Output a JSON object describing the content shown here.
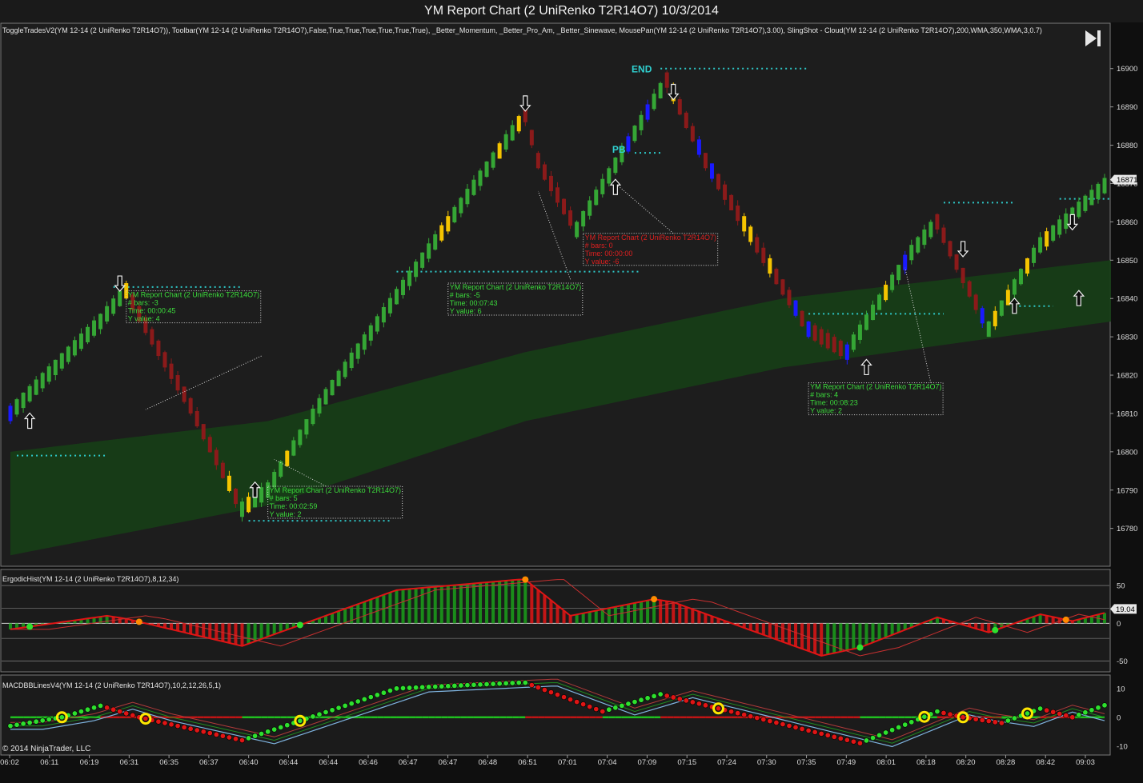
{
  "window": {
    "title": "YM Report Chart (2 UniRenko T2R14O7)  10/3/2014"
  },
  "chart_data": [
    {
      "type": "candlestick",
      "panel": "price",
      "indicator_label": "ToggleTradesV2(YM 12-14 (2 UniRenko T2R14O7)), Toolbar(YM 12-14 (2 UniRenko T2R14O7),False,True,True,True,True,True,True), _Better_Momentum, _Better_Pro_Am, _Better_Sinewave, MousePan(YM 12-14 (2 UniRenko T2R14O7),3.00), SlingShot - Cloud(YM 12-14 (2 UniRenko T2R14O7),200,WMA,350,WMA,3,0.7)",
      "ylim": [
        16772,
        16906
      ],
      "y_ticks": [
        "16900",
        "16890",
        "16880",
        "16870",
        "16860",
        "16850",
        "16840",
        "16830",
        "16820",
        "16810",
        "16800",
        "16790",
        "16780"
      ],
      "y_tick_values": [
        16900,
        16890,
        16880,
        16870,
        16860,
        16850,
        16840,
        16830,
        16820,
        16810,
        16800,
        16790,
        16780
      ],
      "last_price": "16871",
      "last_price_value": 16871,
      "x_ticks": [
        "06:02",
        "06:11",
        "06:19",
        "06:31",
        "06:35",
        "06:37",
        "06:40",
        "06:44",
        "06:44",
        "06:46",
        "06:47",
        "06:47",
        "06:48",
        "06:51",
        "07:01",
        "07:04",
        "07:09",
        "07:15",
        "07:24",
        "07:30",
        "07:35",
        "07:49",
        "08:01",
        "08:18",
        "08:20",
        "08:28",
        "08:42",
        "09:03"
      ],
      "bar_count": 171,
      "bar_color_legend": {
        "up": "#35a635",
        "down": "#8b1a1a",
        "neutral": "#f5c400",
        "signal": "#1a1aff"
      },
      "anchors": [
        [
          0,
          16810
        ],
        [
          14,
          16834
        ],
        [
          18,
          16842
        ],
        [
          22,
          16830
        ],
        [
          28,
          16812
        ],
        [
          36,
          16785
        ],
        [
          40,
          16790
        ],
        [
          48,
          16812
        ],
        [
          80,
          16888
        ],
        [
          82,
          16876
        ],
        [
          88,
          16858
        ],
        [
          93,
          16872
        ],
        [
          102,
          16897
        ],
        [
          108,
          16876
        ],
        [
          124,
          16832
        ],
        [
          130,
          16826
        ],
        [
          140,
          16852
        ],
        [
          144,
          16860
        ],
        [
          152,
          16832
        ],
        [
          160,
          16854
        ],
        [
          171,
          16871
        ]
      ],
      "cloud": {
        "x": [
          0,
          40,
          80,
          120,
          171
        ],
        "top": [
          16800,
          16808,
          16826,
          16840,
          16850
        ],
        "bottom": [
          16773,
          16786,
          16808,
          16822,
          16834
        ]
      },
      "dotted_levels": [
        {
          "from": 1,
          "to": 15,
          "value": 16799
        },
        {
          "from": 16,
          "to": 36,
          "value": 16843
        },
        {
          "from": 37,
          "to": 59,
          "value": 16782
        },
        {
          "from": 60,
          "to": 98,
          "value": 16847
        },
        {
          "from": 101,
          "to": 124,
          "value": 16900
        },
        {
          "from": 97,
          "to": 101,
          "value": 16878
        },
        {
          "from": 124,
          "to": 145,
          "value": 16836
        },
        {
          "from": 145,
          "to": 156,
          "value": 16865
        },
        {
          "from": 156,
          "to": 162,
          "value": 16838
        },
        {
          "from": 163,
          "to": 171,
          "value": 16866
        }
      ],
      "annotations": [
        {
          "text": "END",
          "bar": 98,
          "value": 16899,
          "color": "#30d0d0"
        },
        {
          "text": "PB",
          "bar": 95,
          "value": 16878,
          "color": "#30d0d0"
        }
      ],
      "arrows": [
        {
          "bar": 3,
          "dir": "up",
          "value": 16808
        },
        {
          "bar": 17,
          "dir": "down",
          "value": 16844
        },
        {
          "bar": 38,
          "dir": "up",
          "value": 16790
        },
        {
          "bar": 80,
          "dir": "down",
          "value": 16891
        },
        {
          "bar": 94,
          "dir": "up",
          "value": 16869
        },
        {
          "bar": 103,
          "dir": "down",
          "value": 16894
        },
        {
          "bar": 133,
          "dir": "up",
          "value": 16822
        },
        {
          "bar": 148,
          "dir": "down",
          "value": 16853
        },
        {
          "bar": 156,
          "dir": "up",
          "value": 16838
        },
        {
          "bar": 166,
          "dir": "up",
          "value": 16840
        },
        {
          "bar": 165,
          "dir": "down",
          "value": 16860
        }
      ],
      "notes": [
        {
          "title": "YM Report Chart (2 UniRenko T2R14O7)",
          "lines": [
            "# bars:   -3",
            "Time:     00:00:45",
            "Y value: 4"
          ],
          "color": "#3cdc3c",
          "box_at": [
            18,
            16842
          ],
          "ptr_from": [
            39,
            16825
          ],
          "ptr_to": [
            21,
            16811
          ]
        },
        {
          "title": "YM Report Chart (2 UniRenko T2R14O7)",
          "lines": [
            "# bars:   5",
            "Time:     00:02:59",
            "Y value: 2"
          ],
          "color": "#3cdc3c",
          "box_at": [
            40,
            16791
          ],
          "ptr_from": [
            49,
            16791
          ],
          "ptr_to": [
            41,
            16798
          ]
        },
        {
          "title": "YM Report Chart (2 UniRenko T2R14O7)",
          "lines": [
            "# bars:   -5",
            "Time:     00:07:43",
            "Y value: 6"
          ],
          "color": "#3cdc3c",
          "box_at": [
            68,
            16844
          ],
          "ptr_from": [
            87,
            16845
          ],
          "ptr_to": [
            82,
            16868
          ]
        },
        {
          "title": "YM Report Chart (2 UniRenko T2R14O7)",
          "lines": [
            "# bars:   0",
            "Time:     00:00:00",
            "Y value: -6"
          ],
          "color": "#dc2020",
          "box_at": [
            89,
            16857
          ],
          "ptr_from": [
            103,
            16857
          ],
          "ptr_to": [
            94,
            16870
          ]
        },
        {
          "title": "YM Report Chart (2 UniRenko T2R14O7)",
          "lines": [
            "# bars:   4",
            "Time:     00:08:23",
            "Y value: 2"
          ],
          "color": "#3cdc3c",
          "box_at": [
            124,
            16818
          ],
          "ptr_from": [
            143,
            16818
          ],
          "ptr_to": [
            139,
            16848
          ]
        }
      ]
    },
    {
      "type": "histogram",
      "panel": "ergodic",
      "indicator_label": "ErgodicHist(YM 12-14 (2 UniRenko T2R14O7),8,12,34)",
      "ylim": [
        -60,
        65
      ],
      "y_ticks": [
        "50",
        "0",
        "-50"
      ],
      "y_tick_values": [
        50,
        0,
        -50
      ],
      "last_value": "19.04",
      "anchors": [
        [
          0,
          -8
        ],
        [
          15,
          10
        ],
        [
          18,
          6
        ],
        [
          36,
          -30
        ],
        [
          60,
          44
        ],
        [
          79,
          58
        ],
        [
          80,
          58
        ],
        [
          87,
          10
        ],
        [
          100,
          32
        ],
        [
          103,
          28
        ],
        [
          126,
          -43
        ],
        [
          132,
          -32
        ],
        [
          144,
          8
        ],
        [
          152,
          -12
        ],
        [
          160,
          12
        ],
        [
          165,
          3
        ],
        [
          171,
          16
        ]
      ],
      "signal_offset": -6,
      "colors": {
        "up": "#1aa01a",
        "down": "#e01515",
        "signal": "#1a7a1a"
      }
    },
    {
      "type": "line",
      "panel": "macdbb",
      "indicator_label": "MACDBBLinesV4(YM 12-14 (2 UniRenko T2R14O7),10,2,12,26,5,1)",
      "ylim": [
        -12,
        13
      ],
      "y_ticks": [
        "10",
        "0",
        "-10"
      ],
      "y_tick_values": [
        10,
        0,
        -10
      ],
      "anchors": [
        [
          0,
          -3
        ],
        [
          8,
          0
        ],
        [
          14,
          4
        ],
        [
          20,
          0
        ],
        [
          36,
          -8
        ],
        [
          60,
          10
        ],
        [
          79,
          12
        ],
        [
          80,
          12
        ],
        [
          92,
          2
        ],
        [
          101,
          8
        ],
        [
          132,
          -9
        ],
        [
          144,
          2
        ],
        [
          148,
          0
        ],
        [
          154,
          -2
        ],
        [
          160,
          3
        ],
        [
          165,
          0
        ],
        [
          171,
          5
        ]
      ],
      "dot_up_color": "#2ee02e",
      "dot_down_color": "#e01515",
      "zero_line_colors": {
        "up": "#20c020",
        "down": "#c01515"
      },
      "ring_points": [
        8,
        21,
        45,
        110,
        142,
        148,
        158
      ]
    }
  ],
  "footer": {
    "copyright": "© 2014 NinjaTrader, LLC"
  },
  "icons": {
    "toolbar": "play-skip-icon"
  }
}
